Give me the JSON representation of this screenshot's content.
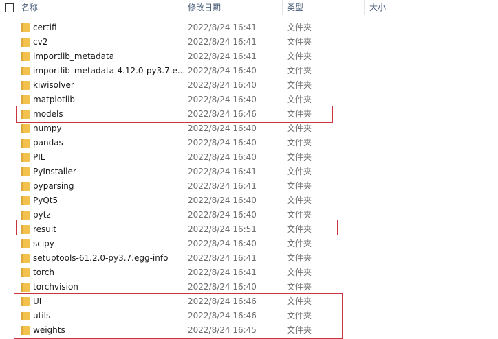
{
  "header": {
    "name": "名称",
    "date": "修改日期",
    "type": "类型",
    "size": "大小"
  },
  "rows": [
    {
      "name": "certifi",
      "date": "2022/8/24 16:41",
      "type": "文件夹"
    },
    {
      "name": "cv2",
      "date": "2022/8/24 16:41",
      "type": "文件夹"
    },
    {
      "name": "importlib_metadata",
      "date": "2022/8/24 16:41",
      "type": "文件夹"
    },
    {
      "name": "importlib_metadata-4.12.0-py3.7.e...",
      "date": "2022/8/24 16:40",
      "type": "文件夹"
    },
    {
      "name": "kiwisolver",
      "date": "2022/8/24 16:40",
      "type": "文件夹"
    },
    {
      "name": "matplotlib",
      "date": "2022/8/24 16:40",
      "type": "文件夹"
    },
    {
      "name": "models",
      "date": "2022/8/24 16:46",
      "type": "文件夹"
    },
    {
      "name": "numpy",
      "date": "2022/8/24 16:40",
      "type": "文件夹"
    },
    {
      "name": "pandas",
      "date": "2022/8/24 16:40",
      "type": "文件夹"
    },
    {
      "name": "PIL",
      "date": "2022/8/24 16:40",
      "type": "文件夹"
    },
    {
      "name": "PyInstaller",
      "date": "2022/8/24 16:41",
      "type": "文件夹"
    },
    {
      "name": "pyparsing",
      "date": "2022/8/24 16:41",
      "type": "文件夹"
    },
    {
      "name": "PyQt5",
      "date": "2022/8/24 16:40",
      "type": "文件夹"
    },
    {
      "name": "pytz",
      "date": "2022/8/24 16:40",
      "type": "文件夹"
    },
    {
      "name": "result",
      "date": "2022/8/24 16:51",
      "type": "文件夹"
    },
    {
      "name": "scipy",
      "date": "2022/8/24 16:40",
      "type": "文件夹"
    },
    {
      "name": "setuptools-61.2.0-py3.7.egg-info",
      "date": "2022/8/24 16:41",
      "type": "文件夹"
    },
    {
      "name": "torch",
      "date": "2022/8/24 16:41",
      "type": "文件夹"
    },
    {
      "name": "torchvision",
      "date": "2022/8/24 16:40",
      "type": "文件夹"
    },
    {
      "name": "UI",
      "date": "2022/8/24 16:46",
      "type": "文件夹"
    },
    {
      "name": "utils",
      "date": "2022/8/24 16:46",
      "type": "文件夹"
    },
    {
      "name": "weights",
      "date": "2022/8/24 16:45",
      "type": "文件夹"
    }
  ],
  "colors": {
    "folder": "#f2c14e",
    "folder_dark": "#dca93a",
    "highlight": "#c8343f",
    "header_text": "#4c607a",
    "date_text": "#6d6d6d"
  }
}
